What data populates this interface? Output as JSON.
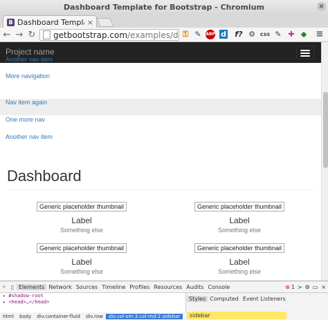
{
  "window": {
    "title": "Dashboard Template for Bootstrap - Chromium"
  },
  "tab": {
    "favicon": "B",
    "title": "Dashboard Template for Bootstrap",
    "close": "×"
  },
  "address": {
    "host": "getbootstrap.com",
    "path": "/examples/dashboard/"
  },
  "extensions": {
    "abp": "ABP",
    "d": "d",
    "f": "f?",
    "css": "css"
  },
  "navbar": {
    "brand": "Project name"
  },
  "sidebar": {
    "items": [
      {
        "label": "Another nav item"
      },
      {
        "label": "More navigation"
      },
      {
        "label": "Nav item again",
        "active": true
      },
      {
        "label": "One more nav"
      },
      {
        "label": "Another nav item"
      }
    ]
  },
  "main": {
    "title": "Dashboard",
    "placeholders": [
      {
        "thumb": "Generic placeholder thumbnail",
        "label": "Label",
        "sub": "Something else"
      },
      {
        "thumb": "Generic placeholder thumbnail",
        "label": "Label",
        "sub": "Something else"
      },
      {
        "thumb": "Generic placeholder thumbnail",
        "label": "Label",
        "sub": "Something else"
      },
      {
        "thumb": "Generic placeholder thumbnail",
        "label": "Label",
        "sub": "Something else"
      }
    ]
  },
  "devtools": {
    "tabs": [
      "Elements",
      "Network",
      "Sources",
      "Timeline",
      "Profiles",
      "Resources",
      "Audits",
      "Console"
    ],
    "errors": "1",
    "dom": [
      "▸ #shadow-root",
      "▸ <head>…</head>"
    ],
    "right_tabs": [
      "Styles",
      "Computed",
      "Event Listeners"
    ],
    "breadcrumbs": [
      "html",
      "body",
      "div.container-fluid",
      "div.row",
      "div.col-sm-3.col-md-2.sidebar"
    ],
    "filter": "sidebar"
  },
  "colors": {
    "navbar_bg": "#222222",
    "link": "#337ab7",
    "active_bg": "#eeeeee"
  }
}
